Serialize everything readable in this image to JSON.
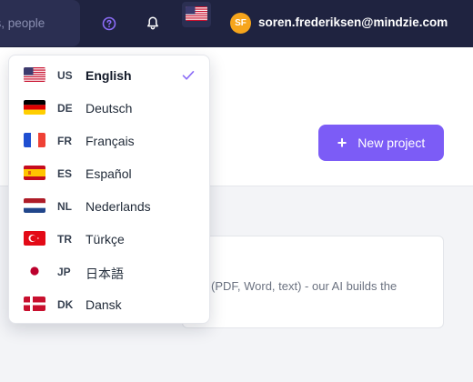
{
  "topbar": {
    "search_placeholder": "cts, people",
    "help_icon": "question-circle-icon",
    "bell_icon": "bell-icon",
    "current_language_flag": "flag-us-icon",
    "avatar_initials": "SF",
    "user_email": "soren.frederiksen@mindzie.com"
  },
  "main": {
    "new_project_label": "New project",
    "card_description": "(PDF, Word, text) - our AI builds the"
  },
  "language_menu": {
    "selected": "US",
    "items": [
      {
        "code": "US",
        "name": "English",
        "flag": "flag-us-icon"
      },
      {
        "code": "DE",
        "name": "Deutsch",
        "flag": "flag-de-icon"
      },
      {
        "code": "FR",
        "name": "Français",
        "flag": "flag-fr-icon"
      },
      {
        "code": "ES",
        "name": "Español",
        "flag": "flag-es-icon"
      },
      {
        "code": "NL",
        "name": "Nederlands",
        "flag": "flag-nl-icon"
      },
      {
        "code": "TR",
        "name": "Türkçe",
        "flag": "flag-tr-icon"
      },
      {
        "code": "JP",
        "name": "日本語",
        "flag": "flag-jp-icon"
      },
      {
        "code": "DK",
        "name": "Dansk",
        "flag": "flag-dk-icon"
      }
    ]
  },
  "colors": {
    "topbar_bg": "#1f2340",
    "accent": "#7c5cf6",
    "avatar": "#f6a51c"
  }
}
